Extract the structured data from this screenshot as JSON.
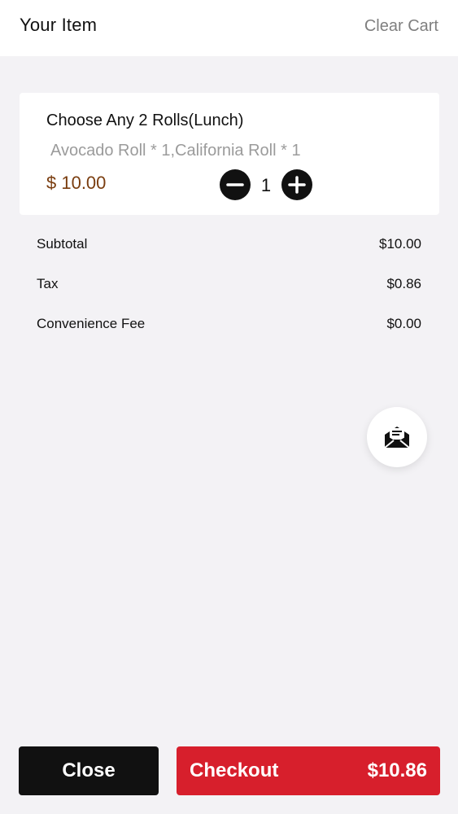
{
  "header": {
    "title": "Your Item",
    "clear_cart": "Clear Cart"
  },
  "cart": {
    "item": {
      "name": "Choose Any 2 Rolls(Lunch)",
      "options": "Avocado Roll * 1,California Roll * 1",
      "price": "$ 10.00",
      "quantity": "1"
    }
  },
  "summary": {
    "subtotal_label": "Subtotal",
    "subtotal_value": "$10.00",
    "tax_label": "Tax",
    "tax_value": "$0.86",
    "fee_label": "Convenience Fee",
    "fee_value": "$0.00"
  },
  "fab": {
    "icon": "mail-icon"
  },
  "footer": {
    "close_label": "Close",
    "checkout_label": "Checkout",
    "checkout_total": "$10.86"
  },
  "colors": {
    "page_background": "#f3f2f5",
    "price_text": "#7a3d0f",
    "checkout_button": "#d71f2c",
    "close_button": "#111111"
  }
}
